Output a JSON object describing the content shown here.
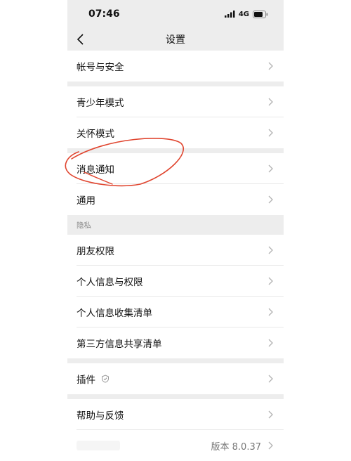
{
  "status_bar": {
    "time": "07:46",
    "network": "4G"
  },
  "nav": {
    "title": "设置"
  },
  "groups": [
    {
      "items": [
        "帐号与安全"
      ]
    },
    {
      "items": [
        "青少年模式",
        "关怀模式"
      ]
    },
    {
      "items": [
        "消息通知",
        "通用"
      ]
    }
  ],
  "privacy": {
    "header": "隐私",
    "items": [
      "朋友权限",
      "个人信息与权限",
      "个人信息收集清单",
      "第三方信息共享清单"
    ]
  },
  "plugins": {
    "label": "插件"
  },
  "help": {
    "label": "帮助与反馈"
  },
  "version": {
    "label": "版本 8.0.37"
  },
  "colors": {
    "page_bg": "#ededed",
    "annotation": "#e0452f"
  }
}
